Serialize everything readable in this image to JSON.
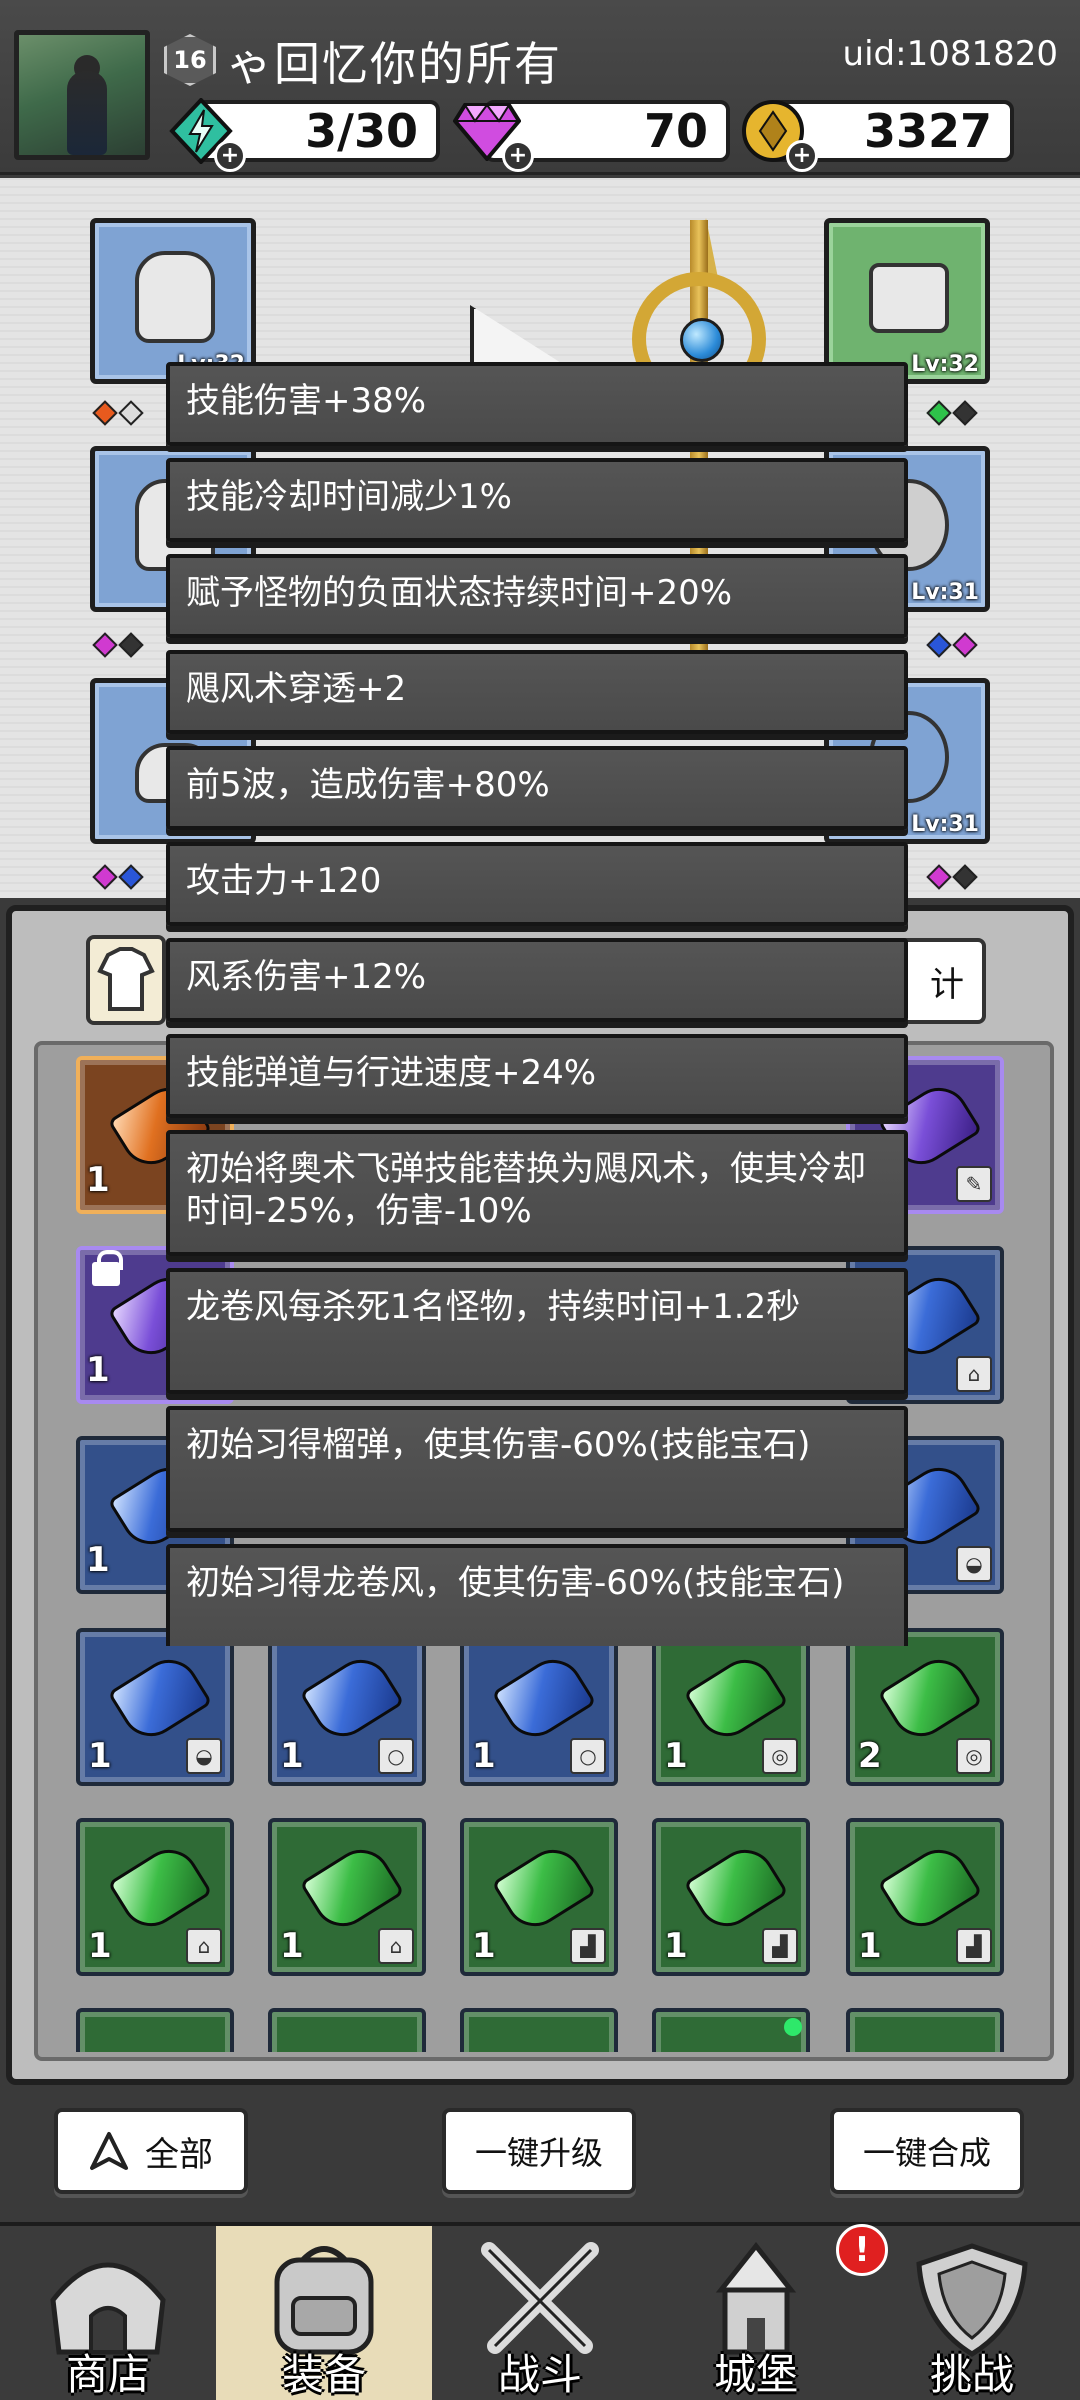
{
  "header": {
    "level": "16",
    "player_name": "ゃ回忆你的所有",
    "uid": "uid:1081820",
    "resources": [
      {
        "icon": "energy-icon",
        "value": "3/30"
      },
      {
        "icon": "gem-icon",
        "value": "70"
      },
      {
        "icon": "coin-icon",
        "value": "3327"
      }
    ]
  },
  "equipment_slots": [
    {
      "slot": "helmet",
      "level": "Lv:32"
    },
    {
      "slot": "gloves",
      "level": "Lv:32"
    },
    {
      "slot": "ring",
      "level": "Lv:31"
    },
    {
      "slot": "necklace",
      "level": "Lv:31"
    }
  ],
  "colors": {
    "tooltip_bg": "#4d4d4d",
    "blue_gem_cell": "#33508a",
    "green_gem_cell": "#2f6b36",
    "purple_gem_cell": "#4e3b8e",
    "orange_gem_cell": "#7b4420",
    "alert": "#e02020"
  },
  "inventory": {
    "right_tab_partial": "计",
    "row1": [
      {
        "count": "1"
      },
      {
        "count": "1"
      },
      {
        "count": "1"
      },
      {
        "count": "1"
      },
      {
        "count": "2"
      }
    ],
    "row2": [
      {
        "count": "1"
      },
      {
        "count": "1"
      },
      {
        "count": "1"
      },
      {
        "count": "1"
      },
      {
        "count": "1"
      }
    ],
    "partial_counts": [
      "1",
      "1",
      "1"
    ]
  },
  "tooltip": {
    "lines": [
      "技能伤害+38%",
      "技能冷却时间减少1%",
      "赋予怪物的负面状态持续时间+20%",
      "飓风术穿透+2",
      "前5波，造成伤害+80%",
      "攻击力+120",
      "风系伤害+12%",
      "技能弹道与行进速度+24%",
      "初始将奥术飞弹技能替换为飓风术，使其冷却时间-25%，伤害-10%",
      "龙卷风每杀死1名怪物，持续时间+1.2秒",
      "初始习得榴弹，使其伤害-60%(技能宝石)",
      "初始习得龙卷风，使其伤害-60%(技能宝石)"
    ]
  },
  "actions": {
    "filter_all": "全部",
    "upgrade_all": "一键升级",
    "merge_all": "一键合成"
  },
  "nav": {
    "shop": "商店",
    "equipment": "装备",
    "battle": "战斗",
    "castle": "城堡",
    "challenge": "挑战",
    "alert_mark": "!"
  }
}
